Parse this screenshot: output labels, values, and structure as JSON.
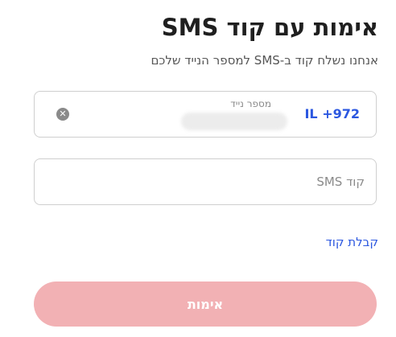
{
  "header": {
    "title": "אימות עם קוד SMS",
    "subtitle": "אנחנו נשלח קוד ב-SMS למספר הנייד שלכם"
  },
  "phone_field": {
    "country_code": "IL +972",
    "label": "מספר נייד",
    "clear_icon": "close-circle-icon"
  },
  "code_field": {
    "placeholder": "קוד SMS",
    "value": ""
  },
  "get_code_link": "קבלת קוד",
  "verify_button": {
    "label": "אימות",
    "color": "#f2b1b4"
  },
  "colors": {
    "accent": "#2b57e0",
    "title": "#1f1f1f",
    "border": "#cfcfcf"
  }
}
